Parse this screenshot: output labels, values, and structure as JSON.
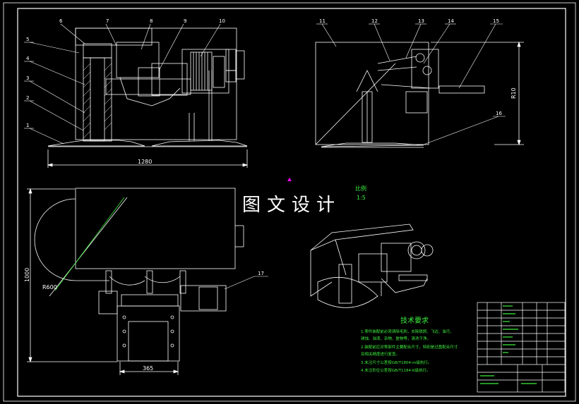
{
  "watermark": "图文设计",
  "scale": {
    "label": "比例",
    "value": "1:5"
  },
  "part_numbers": {
    "front": [
      "1",
      "2",
      "3",
      "4",
      "5",
      "6",
      "7",
      "8",
      "9",
      "10"
    ],
    "side": [
      "11",
      "12",
      "13",
      "14",
      "15",
      "16"
    ],
    "top": [
      "17"
    ]
  },
  "dimensions": {
    "front_width": "1280",
    "side_height": "R10",
    "top_height": "1000",
    "top_radius": "R600",
    "top_width": "365"
  },
  "tech_requirements": {
    "title": "技术要求",
    "lines": [
      "1.零件装配前必须清除毛刺，去除铁屑、飞边、油污、",
      "  锈蚀、油漆、杂物、脏物等，清洗干净。",
      "2.装配前应对零部件主要配合尺寸，特别是过盈配合尺寸",
      "  及相关精度进行复查。",
      "3.未注尺寸公差按GB/T1804-m级执行。",
      "4.未注形位公差按GB/T1184-K级执行。"
    ]
  },
  "colors": {
    "background": "#000000",
    "lines": "#ffffff",
    "annotation": "#3ef03e",
    "marker": "#ff00ff"
  }
}
